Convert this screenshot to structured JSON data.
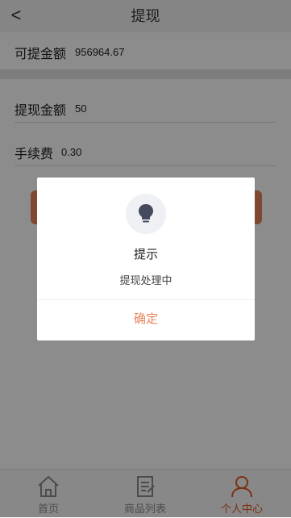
{
  "header": {
    "back_label": "<",
    "title": "提现"
  },
  "balance": {
    "label": "可提金额",
    "value": "956964.67"
  },
  "form": {
    "amount_label": "提现金额",
    "amount_value": "50",
    "fee_label": "手续费",
    "fee_value": "0.30"
  },
  "dialog": {
    "icon": "lightbulb-icon",
    "title": "提示",
    "message": "提现处理中",
    "confirm_label": "确定"
  },
  "tabs": [
    {
      "label": "首页",
      "icon": "home-icon",
      "active": false
    },
    {
      "label": "商品列表",
      "icon": "list-icon",
      "active": false
    },
    {
      "label": "个人中心",
      "icon": "user-icon",
      "active": true
    }
  ],
  "colors": {
    "accent": "#e8835a",
    "active_tab": "#e0581e"
  }
}
